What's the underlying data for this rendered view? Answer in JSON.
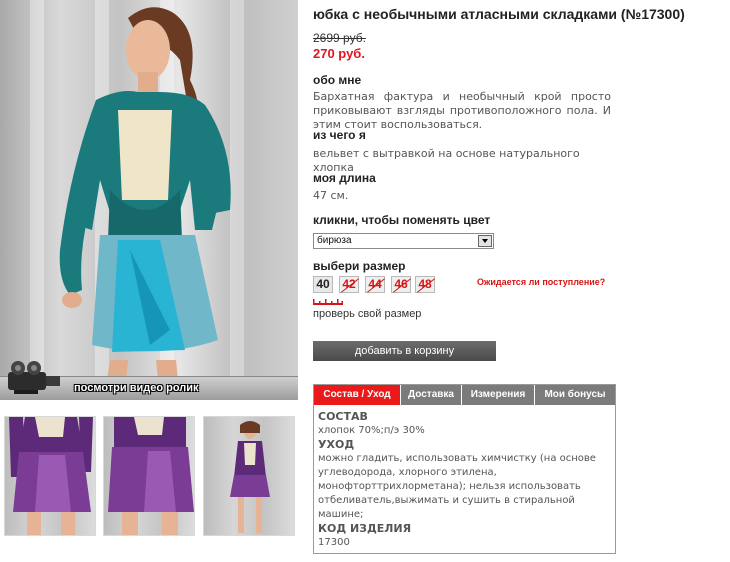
{
  "product": {
    "title": "юбка с необычными атласными складками (№17300)",
    "old_price": "2699 руб.",
    "new_price": "270 руб."
  },
  "media": {
    "video_label": "посмотри видео ролик"
  },
  "about": {
    "heading": "обо мне",
    "text": "Бархатная фактура и необычный крой просто приковывают взгляды противоположного пола. И этим стоит воспользоваться."
  },
  "material": {
    "heading": "из чего я",
    "text": "вельвет с вытравкой на основе натурального хлопка"
  },
  "length": {
    "heading": "моя длина",
    "text": "47 см."
  },
  "color": {
    "heading": "кликни, чтобы поменять цвет",
    "selected": "бирюза"
  },
  "size": {
    "heading": "выбери размер",
    "options": [
      {
        "label": "40",
        "available": true
      },
      {
        "label": "42",
        "available": false
      },
      {
        "label": "44",
        "available": false
      },
      {
        "label": "46",
        "available": false
      },
      {
        "label": "48",
        "available": false
      }
    ],
    "await_link": "Ожидается ли поступление?",
    "check_size": "проверь свой размер"
  },
  "cart": {
    "label": "добавить в корзину"
  },
  "tabs": {
    "items": [
      {
        "label": "Состав / Уход",
        "active": true
      },
      {
        "label": "Доставка",
        "active": false
      },
      {
        "label": "Измерения",
        "active": false
      },
      {
        "label": "Мои бонусы",
        "active": false
      }
    ],
    "content": {
      "composition_heading": "СОСТАВ",
      "composition": "хлопок 70%;п/э 30%",
      "care_heading": "УХОД",
      "care": "можно гладить, использовать химчистку (на основе углеводорода, хлорного этилена, монофторттрихлорметана); нельзя использовать отбеливатель,выжимать и сушить в стиральной машине;",
      "code_heading": "КОД ИЗДЕЛИЯ",
      "code": "17300"
    }
  },
  "colors": {
    "accent_red": "#e0141e",
    "tab_gray": "#7b7b7b",
    "button_gray": "#555555",
    "teal": "#1a7a7c",
    "turquoise": "#29b4d4",
    "purple": "#6a2e82"
  }
}
